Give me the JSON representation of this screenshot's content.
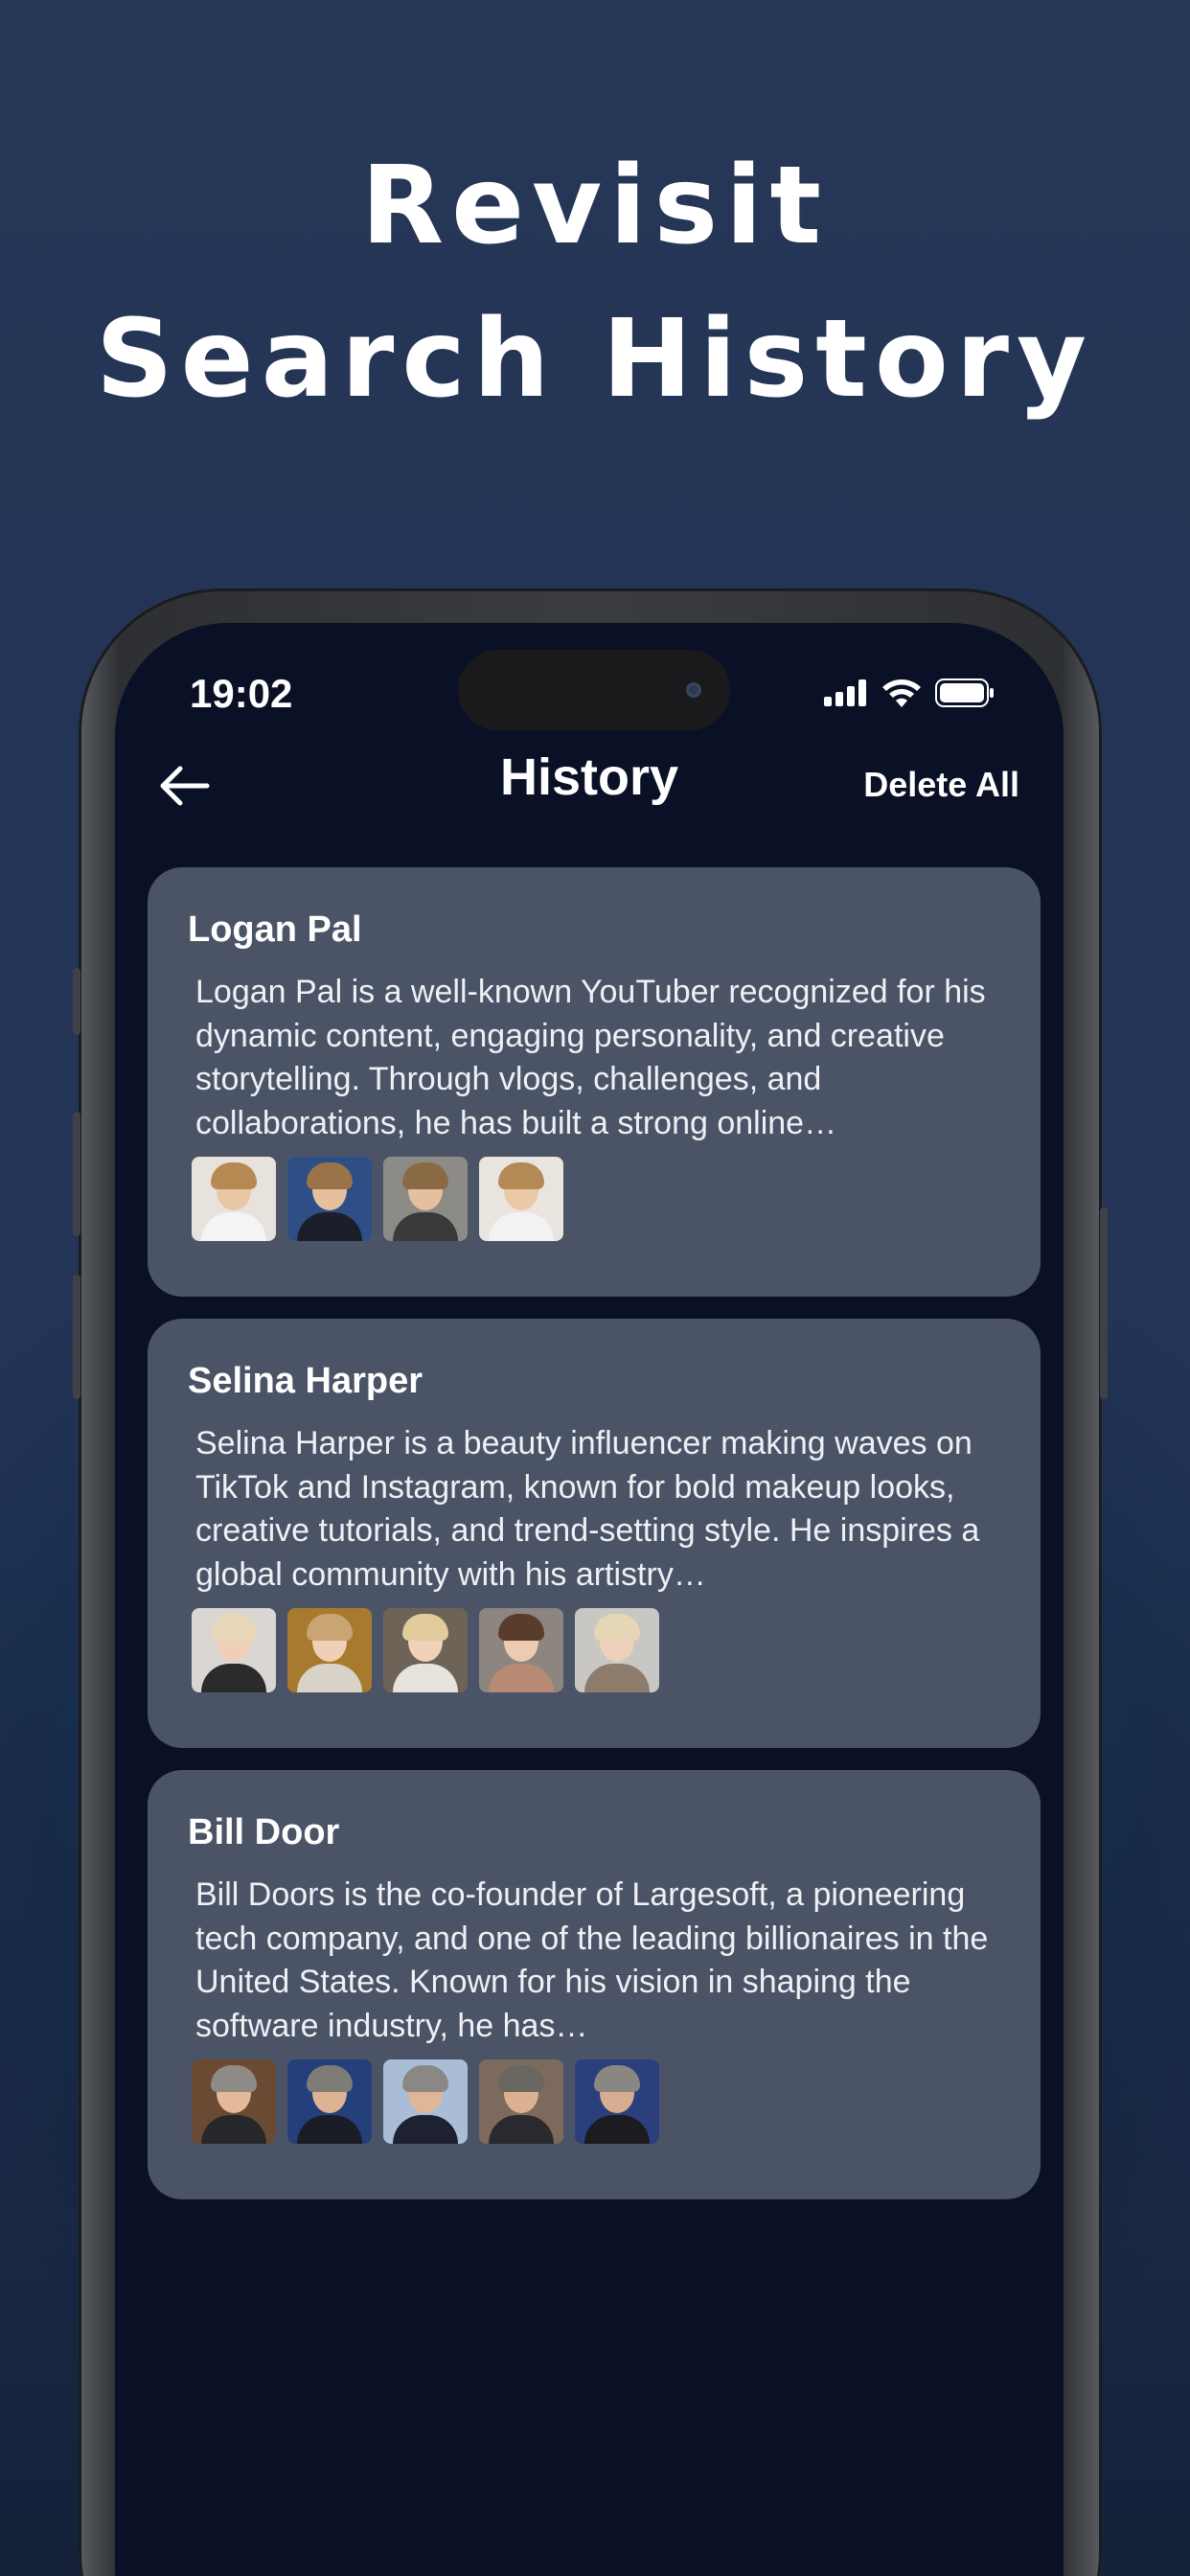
{
  "headline": {
    "line1": "Revisit",
    "line2": "Search History"
  },
  "status_bar": {
    "time": "19:02",
    "icons": [
      "signal-icon",
      "wifi-icon",
      "battery-icon"
    ]
  },
  "nav": {
    "back_icon": "arrow-left-icon",
    "title": "History",
    "action": "Delete All"
  },
  "history": [
    {
      "name": "Logan Pal",
      "description": "Logan Pal is a well-known YouTuber recognized for his dynamic content, engaging personality, and creative storytelling. Through vlogs, challenges, and collaborations, he has built a strong online…",
      "thumbnails": [
        {
          "bg": "#e7e3dc",
          "hair": "#b58a52",
          "skin": "#e9c6a4",
          "shirt": "#f4f4f4"
        },
        {
          "bg": "#2e4f86",
          "hair": "#9a7448",
          "skin": "#e5c09c",
          "shirt": "#1c1f2a"
        },
        {
          "bg": "#8d8b86",
          "hair": "#8a6a44",
          "skin": "#e4c09e",
          "shirt": "#3a3a3c"
        },
        {
          "bg": "#e9e5de",
          "hair": "#b38a55",
          "skin": "#ebc8a6",
          "shirt": "#f2f2f2"
        }
      ]
    },
    {
      "name": "Selina Harper",
      "description": "Selina Harper is a beauty influencer making waves on TikTok and Instagram, known for bold makeup looks, creative tutorials, and trend-setting style. He inspires a global community with his artistry…",
      "thumbnails": [
        {
          "bg": "#d9d6d4",
          "hair": "#e8d7b8",
          "skin": "#efcfb8",
          "shirt": "#2b2b2e"
        },
        {
          "bg": "#a77a2e",
          "hair": "#c9a574",
          "skin": "#efd0b6",
          "shirt": "#d8d2c8"
        },
        {
          "bg": "#6d6457",
          "hair": "#e2cc9c",
          "skin": "#f0d2b8",
          "shirt": "#e6e2dc"
        },
        {
          "bg": "#8c8580",
          "hair": "#5a3c2c",
          "skin": "#eccbb2",
          "shirt": "#b78a74"
        },
        {
          "bg": "#c9c7c4",
          "hair": "#e5d6b6",
          "skin": "#efd0ba",
          "shirt": "#8d7b6b"
        }
      ]
    },
    {
      "name": "Bill Door",
      "description": "Bill Doors is the co-founder of Largesoft, a pioneering tech company, and one of the leading billionaires in the United States.  Known for his vision in shaping the software industry, he has…",
      "thumbnails": [
        {
          "bg": "#6a4a32",
          "hair": "#8e8a86",
          "skin": "#e3b99a",
          "shirt": "#26272c"
        },
        {
          "bg": "#243f7a",
          "hair": "#7f7c78",
          "skin": "#ddb393",
          "shirt": "#1a1c26"
        },
        {
          "bg": "#a9bed6",
          "hair": "#8a8784",
          "skin": "#dfb698",
          "shirt": "#1e2230"
        },
        {
          "bg": "#7d6a5c",
          "hair": "#6a6660",
          "skin": "#dcb192",
          "shirt": "#2a2a2e"
        },
        {
          "bg": "#2a3f7c",
          "hair": "#8a8783",
          "skin": "#d9ae90",
          "shirt": "#1b1b20"
        }
      ]
    }
  ]
}
